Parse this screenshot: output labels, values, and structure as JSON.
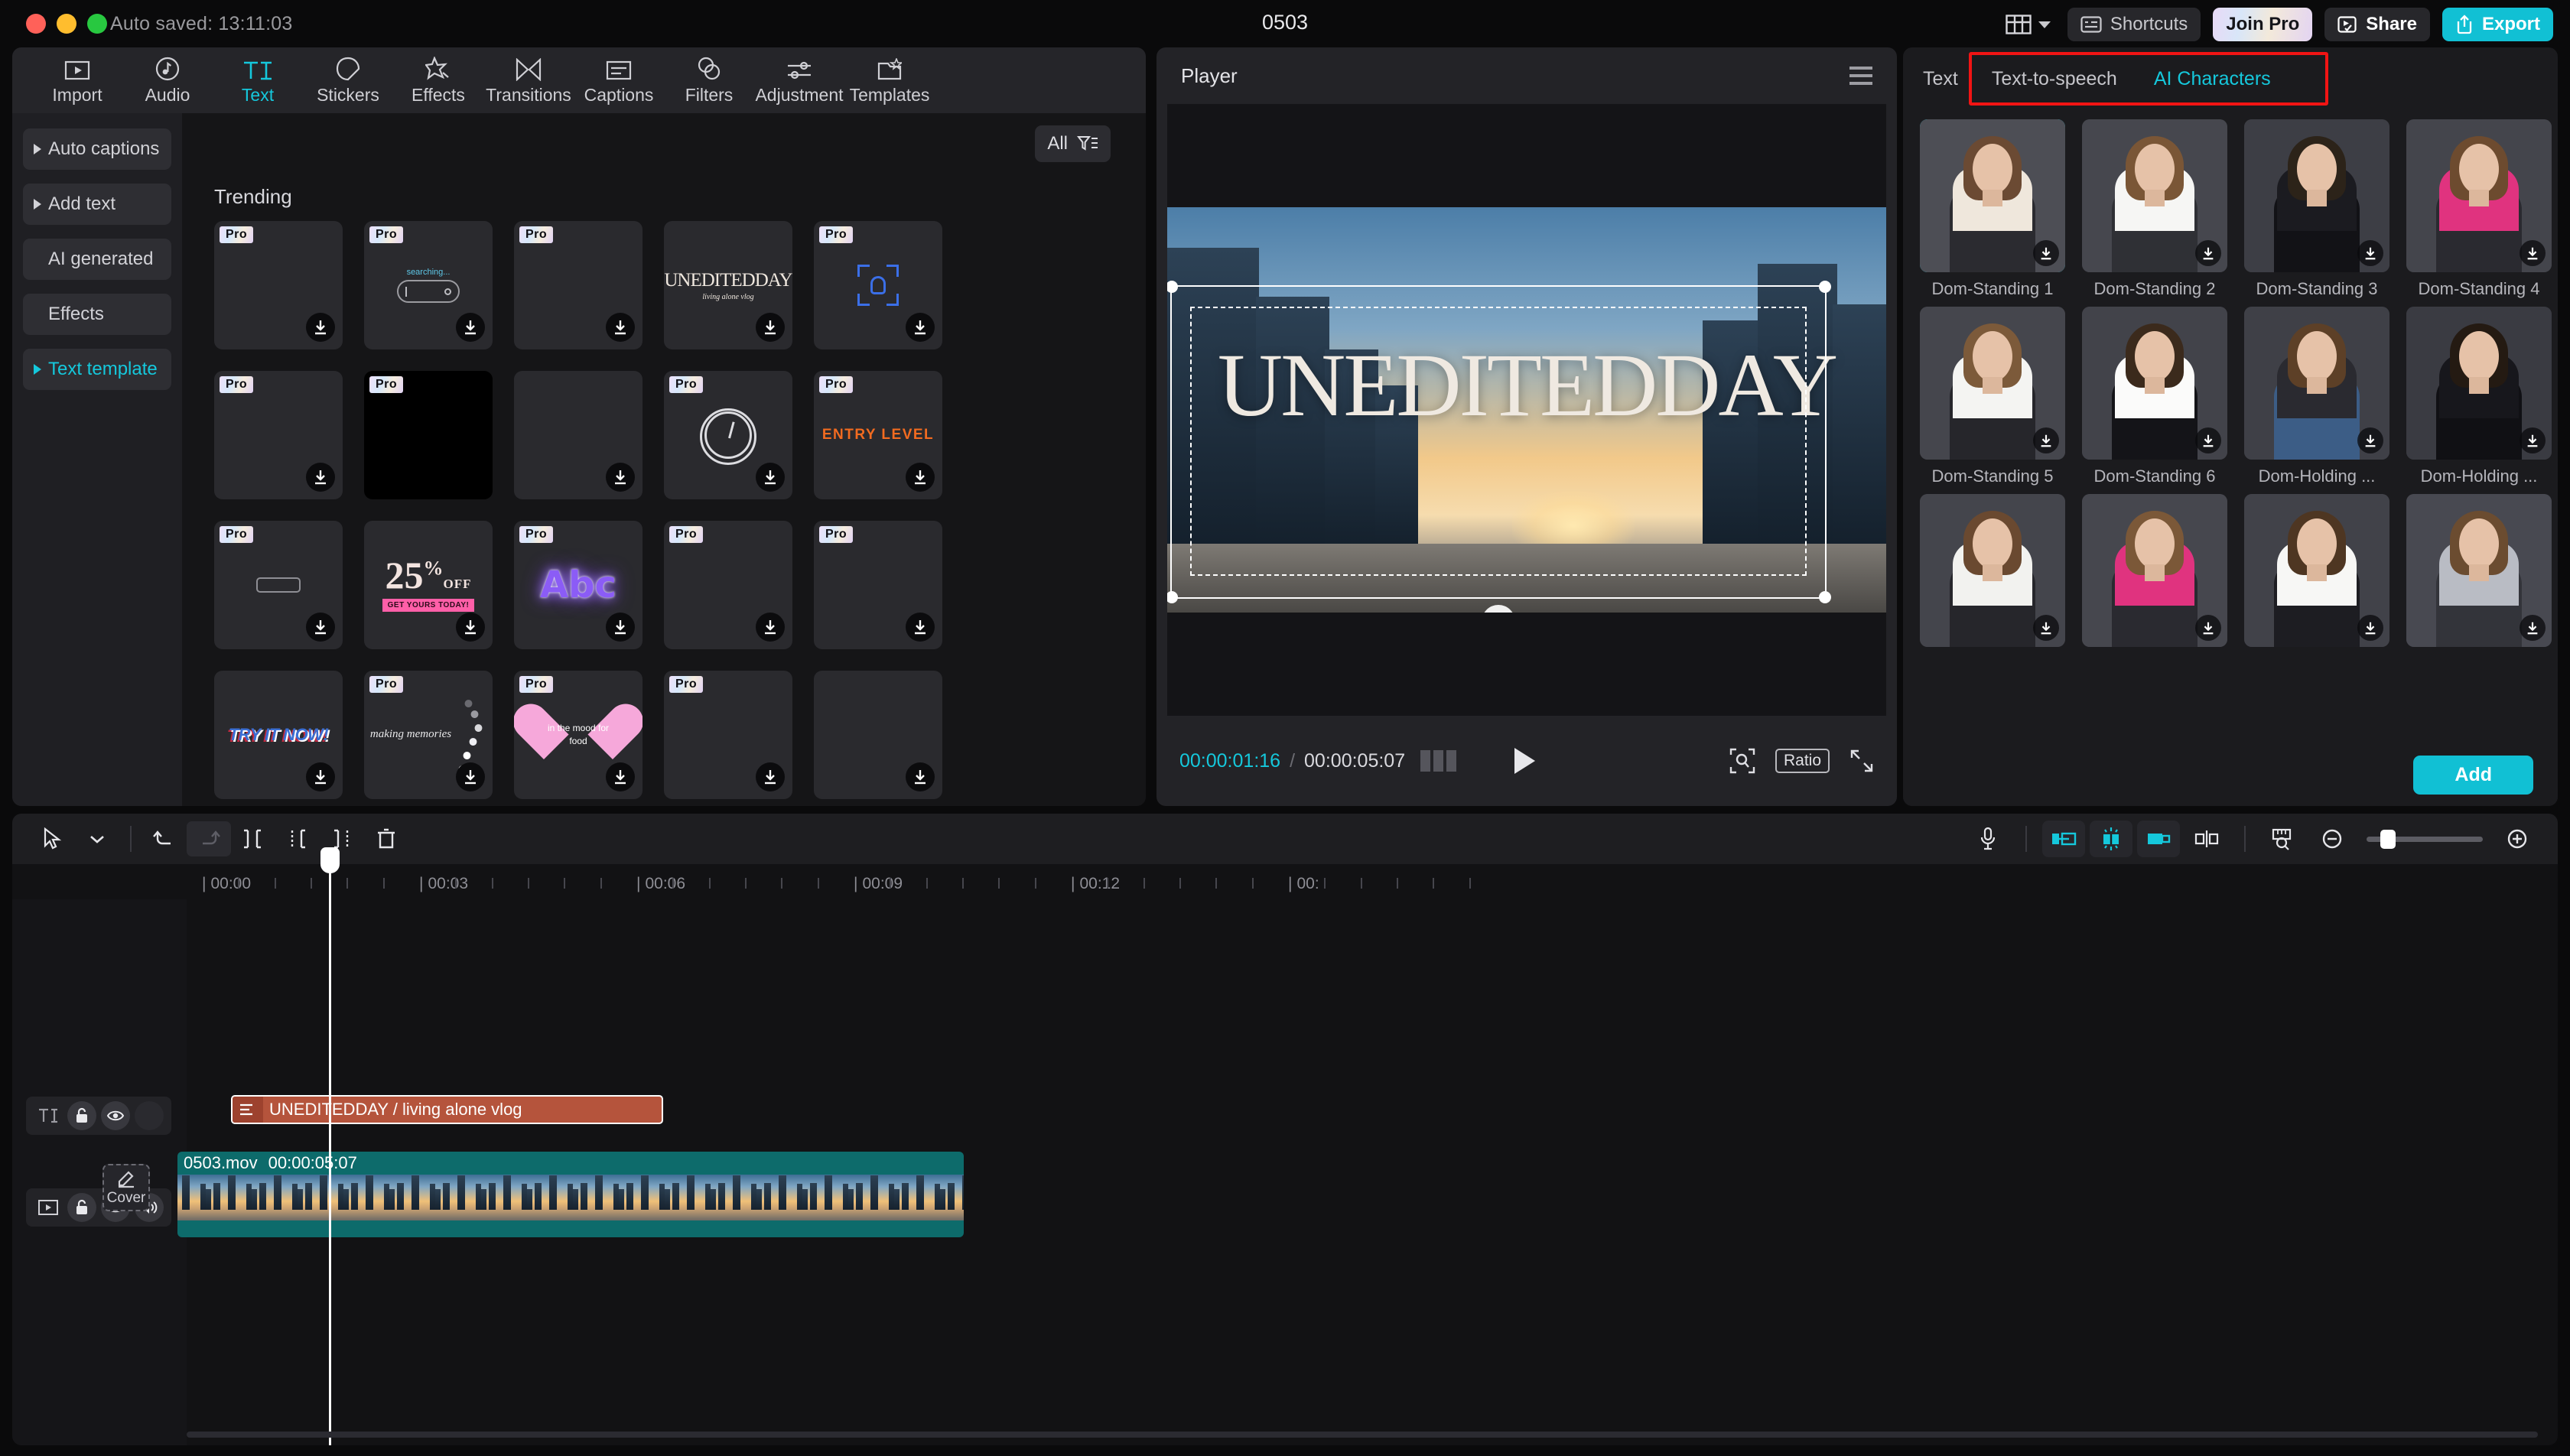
{
  "titlebar": {
    "autosave": "Auto saved: 13:11:03",
    "project_title": "0503",
    "shortcuts_label": "Shortcuts",
    "join_pro_label": "Join Pro",
    "share_label": "Share",
    "export_label": "Export"
  },
  "toolbar": {
    "items": [
      {
        "label": "Import",
        "icon": "import-icon",
        "active": false
      },
      {
        "label": "Audio",
        "icon": "audio-icon",
        "active": false
      },
      {
        "label": "Text",
        "icon": "text-icon",
        "active": true
      },
      {
        "label": "Stickers",
        "icon": "stickers-icon",
        "active": false
      },
      {
        "label": "Effects",
        "icon": "effects-icon",
        "active": false
      },
      {
        "label": "Transitions",
        "icon": "transitions-icon",
        "active": false
      },
      {
        "label": "Captions",
        "icon": "captions-icon",
        "active": false
      },
      {
        "label": "Filters",
        "icon": "filters-icon",
        "active": false
      },
      {
        "label": "Adjustment",
        "icon": "adjustment-icon",
        "active": false
      },
      {
        "label": "Templates",
        "icon": "templates-icon",
        "active": false
      }
    ]
  },
  "sidebar": {
    "items": [
      {
        "label": "Auto captions",
        "expandable": true,
        "active": false
      },
      {
        "label": "Add text",
        "expandable": true,
        "active": false
      },
      {
        "label": "AI generated",
        "expandable": false,
        "active": false
      },
      {
        "label": "Effects",
        "expandable": false,
        "active": false
      },
      {
        "label": "Text template",
        "expandable": true,
        "active": true
      }
    ]
  },
  "gallery": {
    "filter_label": "All",
    "section_title": "Trending",
    "templates": [
      {
        "id": "t1",
        "pro": true,
        "kind": "blank",
        "text": ""
      },
      {
        "id": "t2",
        "pro": true,
        "kind": "searching",
        "text": "searching..."
      },
      {
        "id": "t3",
        "pro": true,
        "kind": "blank",
        "text": ""
      },
      {
        "id": "t4",
        "pro": false,
        "kind": "unedited",
        "text": "UNEDITEDDAY",
        "subtext": "living alone vlog"
      },
      {
        "id": "t5",
        "pro": true,
        "kind": "scan",
        "text": ""
      },
      {
        "id": "t6",
        "pro": true,
        "kind": "blank",
        "text": ""
      },
      {
        "id": "t7",
        "pro": true,
        "kind": "black",
        "text": ""
      },
      {
        "id": "t8",
        "pro": false,
        "kind": "blank",
        "text": ""
      },
      {
        "id": "t9",
        "pro": true,
        "kind": "clock",
        "text": ""
      },
      {
        "id": "t10",
        "pro": true,
        "kind": "entry",
        "text": "ENTRY LEVEL"
      },
      {
        "id": "t11",
        "pro": true,
        "kind": "rect",
        "text": ""
      },
      {
        "id": "t12",
        "pro": false,
        "kind": "discount",
        "text": "25",
        "suptext": "%",
        "subtext": "OFF",
        "badge": "GET YOURS TODAY!"
      },
      {
        "id": "t13",
        "pro": true,
        "kind": "abc",
        "text": "Abc"
      },
      {
        "id": "t14",
        "pro": true,
        "kind": "blank",
        "text": ""
      },
      {
        "id": "t15",
        "pro": true,
        "kind": "blank",
        "text": ""
      },
      {
        "id": "t16",
        "pro": false,
        "kind": "tryit",
        "text": "TRY IT NOW!"
      },
      {
        "id": "t17",
        "pro": true,
        "kind": "memories",
        "text": "making memories"
      },
      {
        "id": "t18",
        "pro": true,
        "kind": "heart",
        "text": "in the mood for food"
      },
      {
        "id": "t19",
        "pro": true,
        "kind": "blank",
        "text": ""
      },
      {
        "id": "t20",
        "pro": false,
        "kind": "blank",
        "text": ""
      }
    ]
  },
  "player": {
    "title": "Player",
    "overlay_text": "UNEDITEDDAY",
    "current_time": "00:00:01:16",
    "separator": "/",
    "total_time": "00:00:05:07",
    "ratio_label": "Ratio"
  },
  "right_panel": {
    "tabs": [
      {
        "label": "Text",
        "active": false,
        "highlighted": false
      },
      {
        "label": "Text-to-speech",
        "active": false,
        "highlighted": true
      },
      {
        "label": "AI Characters",
        "active": true,
        "highlighted": true
      }
    ],
    "add_label": "Add",
    "characters": [
      {
        "label": "Dom-Standing 1",
        "selected": true,
        "hair": "#6b4a33",
        "top": "#efe7dc",
        "bottom": "#2b2b30",
        "bg": "#4d4e55"
      },
      {
        "label": "Dom-Standing 2",
        "selected": false,
        "hair": "#7a5636",
        "top": "#f6f6f4",
        "bottom": "#2f3035",
        "bg": "#46474e"
      },
      {
        "label": "Dom-Standing 3",
        "selected": false,
        "hair": "#2c2319",
        "top": "#1b1b20",
        "bottom": "#121216",
        "bg": "#3d3e45"
      },
      {
        "label": "Dom-Standing 4",
        "selected": false,
        "hair": "#6d4b2f",
        "top": "#e0337f",
        "bottom": "#2a2a30",
        "bg": "#44454c"
      },
      {
        "label": "Dom-Standing 5",
        "selected": false,
        "hair": "#7c5a3a",
        "top": "#f4f4f2",
        "bottom": "#26262b",
        "bg": "#45464d"
      },
      {
        "label": "Dom-Standing 6",
        "selected": false,
        "hair": "#3b2a1c",
        "top": "#fbfbfa",
        "bottom": "#141418",
        "bg": "#42434a"
      },
      {
        "label": "Dom-Holding ...",
        "selected": false,
        "hair": "#5d4027",
        "top": "#2a2a30",
        "bottom": "#3c5d86",
        "bg": "#3f4047"
      },
      {
        "label": "Dom-Holding ...",
        "selected": false,
        "hair": "#241a12",
        "top": "#17171c",
        "bottom": "#101014",
        "bg": "#3a3b42"
      },
      {
        "label": "",
        "selected": false,
        "hair": "#6a4930",
        "top": "#f2f2ef",
        "bottom": "#26262b",
        "bg": "#44454c"
      },
      {
        "label": "",
        "selected": false,
        "hair": "#7b5838",
        "top": "#e0337f",
        "bottom": "#2a2a30",
        "bg": "#46474e"
      },
      {
        "label": "",
        "selected": false,
        "hair": "#4e3622",
        "top": "#f7f7f5",
        "bottom": "#1d1d22",
        "bg": "#414249"
      },
      {
        "label": "",
        "selected": false,
        "hair": "#6b4c30",
        "top": "#b9bcc4",
        "bottom": "#33343a",
        "bg": "#484951"
      }
    ]
  },
  "timeline": {
    "toolbar": {
      "select_icon": "cursor-select-icon",
      "dropdown_icon": "chevron-down-icon",
      "undo_icon": "undo-icon",
      "redo_icon": "redo-icon",
      "split_icon": "split-icon",
      "trim_start_icon": "trim-start-icon",
      "trim_end_icon": "trim-end-icon",
      "delete_icon": "delete-icon",
      "mic_icon": "microphone-icon",
      "mix_left_icon": "audio-mix-left-icon",
      "mix_center_icon": "audio-detach-icon",
      "mix_right_icon": "audio-mix-right-icon",
      "marker_icon": "marker-icon",
      "ruler_icon": "ruler-zoom-icon",
      "zoom_out_icon": "zoom-out-icon",
      "zoom_in_icon": "zoom-in-icon"
    },
    "ruler_labels": [
      "00:00",
      "00:03",
      "00:06",
      "00:09",
      "00:12",
      "00:"
    ],
    "tracks": [
      {
        "type": "text",
        "icon": "text-track-icon",
        "lock": "unlocked",
        "visible": true,
        "has_audio": false
      },
      {
        "type": "video",
        "icon": "video-track-icon",
        "lock": "unlocked",
        "visible": true,
        "has_audio": true
      }
    ],
    "text_clip": {
      "label": "UNEDITEDDAY / living alone vlog"
    },
    "video_clip": {
      "name": "0503.mov",
      "duration": "00:00:05:07"
    },
    "cover_label": "Cover"
  },
  "colors": {
    "accent": "#15c8dc",
    "export": "#11c0d4",
    "highlight_box": "#f11414",
    "video_clip": "#0d6b6b",
    "text_clip": "#b5543c"
  }
}
